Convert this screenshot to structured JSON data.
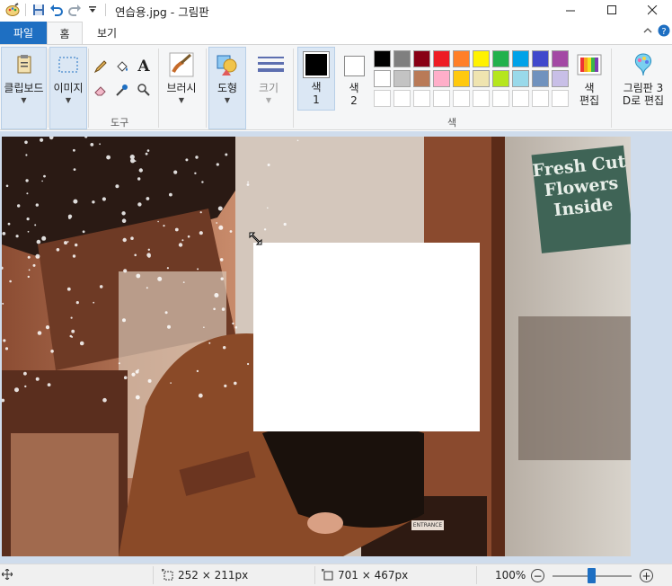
{
  "window": {
    "title": "연습용.jpg - 그림판",
    "minimize": "—",
    "maximize": "☐",
    "close": "✕"
  },
  "tabs": {
    "file": "파일",
    "home": "홈",
    "view": "보기",
    "collapse": "^",
    "help": "?"
  },
  "ribbon": {
    "clipboard": "클립보드",
    "image": "이미지",
    "tools_group": "도구",
    "brushes": "브러시",
    "shapes": "도형",
    "size": "크기",
    "color1": "색\n1",
    "color1_a": "색",
    "color1_b": "1",
    "color2_a": "색",
    "color2_b": "2",
    "colors_group": "색",
    "edit_colors_a": "색",
    "edit_colors_b": "편집",
    "paint3d_a": "그림판 3",
    "paint3d_b": "D로 편집",
    "palette": [
      "#000000",
      "#7f7f7f",
      "#880015",
      "#ed1c24",
      "#ff7f27",
      "#fff200",
      "#22b14c",
      "#00a2e8",
      "#3f48cc",
      "#a349a4",
      "#ffffff",
      "#c3c3c3",
      "#b97a57",
      "#ffaec9",
      "#ffc90e",
      "#efe4b0",
      "#b5e61d",
      "#99d9ea",
      "#7092be",
      "#c8bfe7",
      "#ffffff",
      "#ffffff",
      "#ffffff",
      "#ffffff",
      "#ffffff",
      "#ffffff",
      "#ffffff",
      "#ffffff",
      "#ffffff",
      "#ffffff"
    ],
    "current_color1": "#000000",
    "current_color2": "#ffffff"
  },
  "canvas": {
    "sign_line1": "Fresh Cut",
    "sign_line2": "Flowers",
    "sign_line3": "Inside",
    "small_sign": "ENTRANCE"
  },
  "status": {
    "selection_size": "252 × 211px",
    "image_size": "701 × 467px",
    "zoom": "100%",
    "zoom_level": 1.0
  }
}
